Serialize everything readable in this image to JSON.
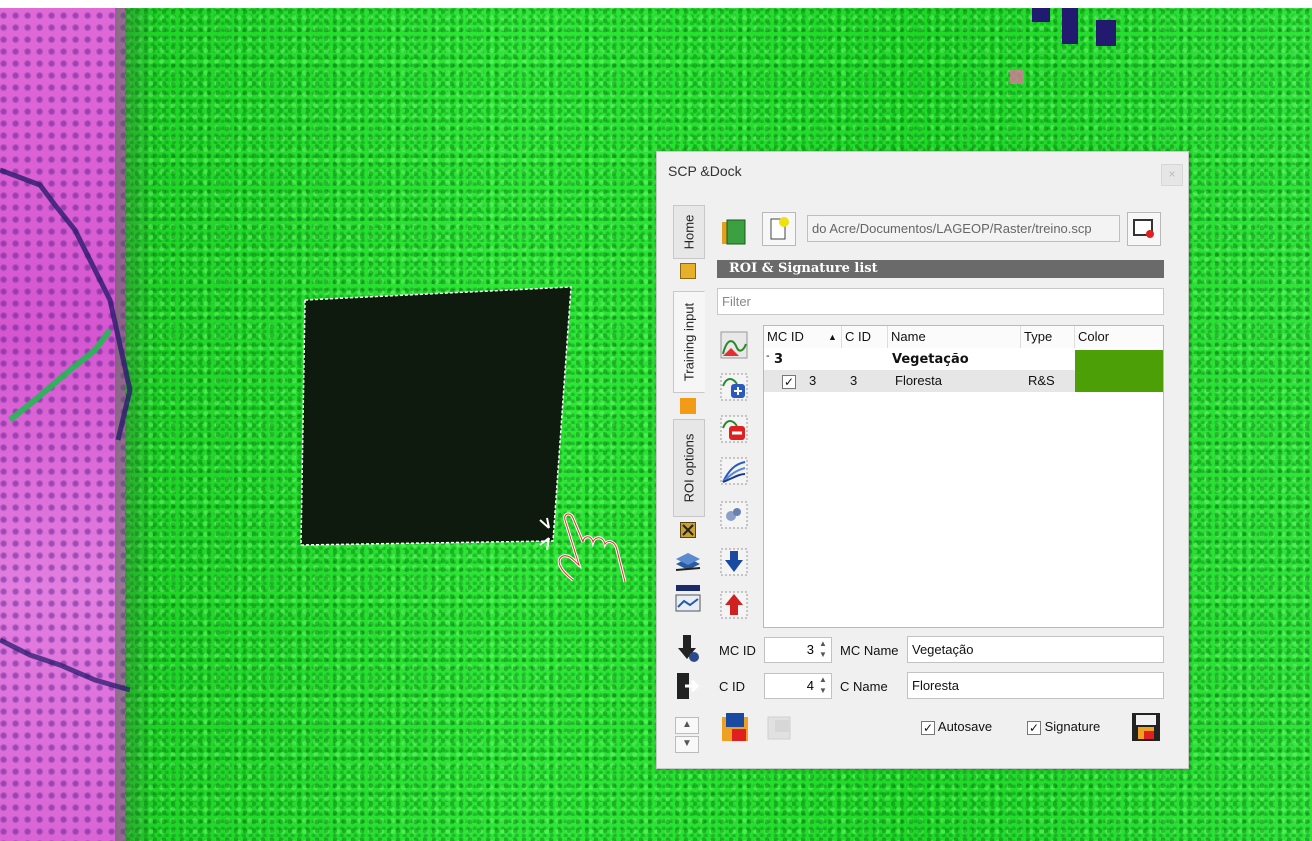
{
  "dock": {
    "title": "SCP &Dock",
    "close": "×",
    "tabs": {
      "home": "Home",
      "training_input": "Training input",
      "roi_options": "ROI options"
    },
    "training_file_path": "do Acre/Documentos/LAGEOP/Raster/treino.scp",
    "section_title": "ROI & Signature list",
    "filter_placeholder": "Filter",
    "table": {
      "columns": [
        "MC ID",
        "C ID",
        "Name",
        "Type",
        "Color"
      ],
      "sort_indicator": "▲",
      "group": {
        "expander": "-",
        "mc_id": "3",
        "name": "Vegetação",
        "color": "#4d9f07"
      },
      "rows": [
        {
          "checked": "✓",
          "mc_id": "3",
          "c_id": "3",
          "name": "Floresta",
          "type": "R&S",
          "color": "#4d9f07"
        }
      ]
    },
    "form": {
      "mc_id_label": "MC ID",
      "mc_id_value": "3",
      "mc_name_label": "MC Name",
      "mc_name_value": "Vegetação",
      "c_id_label": "C ID",
      "c_id_value": "4",
      "c_name_label": "C Name",
      "c_name_value": "Floresta",
      "autosave_label": "Autosave",
      "autosave_checked": "✓",
      "signature_label": "Signature",
      "signature_checked": "✓"
    },
    "spin_arrows": "▲\n▼",
    "scroll_up": "▲",
    "scroll_down": "▼"
  }
}
